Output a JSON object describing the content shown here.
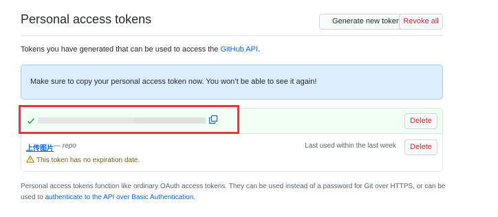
{
  "header": {
    "title": "Personal access tokens",
    "generate_label": "Generate new token",
    "revoke_label": "Revoke all"
  },
  "intro": {
    "text": "Tokens you have generated that can be used to access the ",
    "link": "GitHub API",
    "suffix": "."
  },
  "flash": {
    "text": "Make sure to copy your personal access token now. You won’t be able to see it again!"
  },
  "new_token": {
    "icons": {
      "status": "check-icon",
      "copy": "copy-icon"
    },
    "delete_label": "Delete"
  },
  "token": {
    "name": "上传图片",
    "scope": "— repo",
    "last_used": "Last used within the last week",
    "warning": "This token has no expiration date.",
    "delete_label": "Delete",
    "icons": {
      "warning": "alert-triangle-icon"
    }
  },
  "footer": {
    "text": "Personal access tokens function like ordinary OAuth access tokens. They can be used instead of a password for Git over HTTPS, or can be used to ",
    "link": "authenticate to the API over Basic Authentication",
    "suffix": "."
  },
  "colors": {
    "link": "#0366d6",
    "danger": "#cb2431",
    "flash_bg": "#dbedff",
    "new_token_bg": "#f0fff4",
    "highlight": "#e5353a",
    "warning": "#735c0f"
  }
}
